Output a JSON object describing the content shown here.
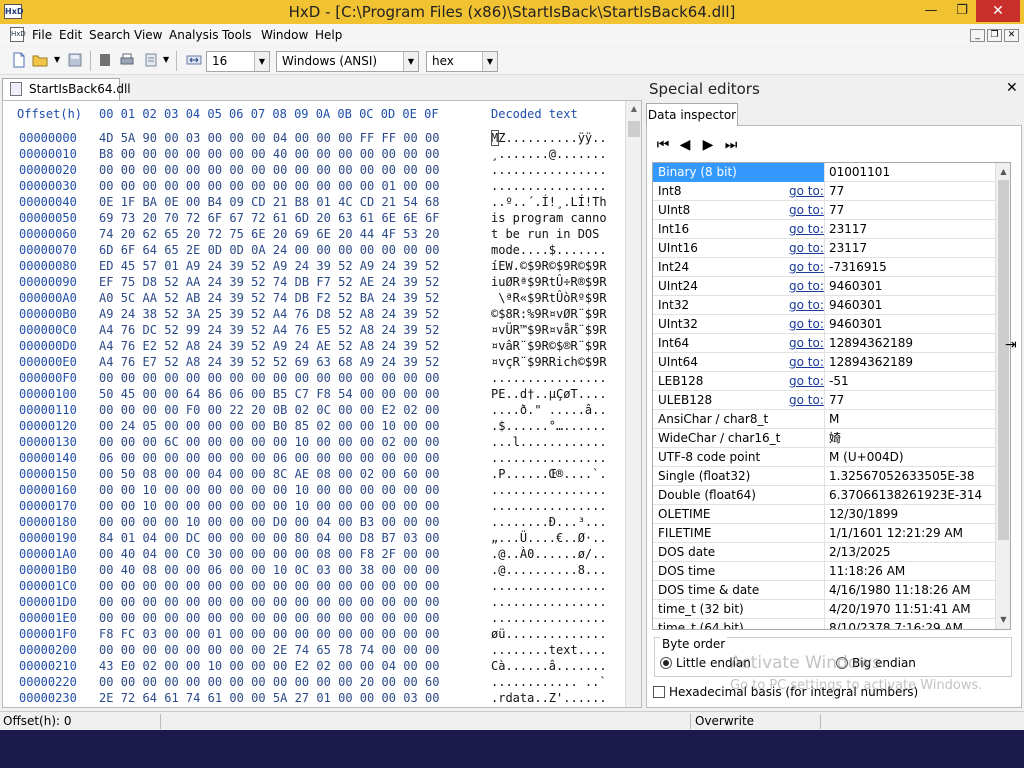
{
  "window": {
    "title": "HxD - [C:\\Program Files (x86)\\StartIsBack\\StartIsBack64.dll]",
    "app_icon": "HxD"
  },
  "menu": [
    "File",
    "Edit",
    "Search",
    "View",
    "Analysis",
    "Tools",
    "Window",
    "Help"
  ],
  "toolbar": {
    "bytes_per_row": "16",
    "charset": "Windows (ANSI)",
    "offset_base": "hex"
  },
  "document_tab": "StartIsBack64.dll",
  "hex": {
    "header_offset": "Offset(h)",
    "header_columns": [
      "00",
      "01",
      "02",
      "03",
      "04",
      "05",
      "06",
      "07",
      "08",
      "09",
      "0A",
      "0B",
      "0C",
      "0D",
      "0E",
      "0F"
    ],
    "header_text": "Decoded text",
    "rows": [
      {
        "o": "00000000",
        "h": "4D 5A 90 00 03 00 00 00 04 00 00 00 FF FF 00 00",
        "t": "MZ..........ÿÿ.."
      },
      {
        "o": "00000010",
        "h": "B8 00 00 00 00 00 00 00 40 00 00 00 00 00 00 00",
        "t": "¸.......@......."
      },
      {
        "o": "00000020",
        "h": "00 00 00 00 00 00 00 00 00 00 00 00 00 00 00 00",
        "t": "................"
      },
      {
        "o": "00000030",
        "h": "00 00 00 00 00 00 00 00 00 00 00 00 00 01 00 00",
        "t": "................"
      },
      {
        "o": "00000040",
        "h": "0E 1F BA 0E 00 B4 09 CD 21 B8 01 4C CD 21 54 68",
        "t": "..º..´.Í!¸.LÍ!Th"
      },
      {
        "o": "00000050",
        "h": "69 73 20 70 72 6F 67 72 61 6D 20 63 61 6E 6E 6F",
        "t": "is program canno"
      },
      {
        "o": "00000060",
        "h": "74 20 62 65 20 72 75 6E 20 69 6E 20 44 4F 53 20",
        "t": "t be run in DOS "
      },
      {
        "o": "00000070",
        "h": "6D 6F 64 65 2E 0D 0D 0A 24 00 00 00 00 00 00 00",
        "t": "mode....$......."
      },
      {
        "o": "00000080",
        "h": "ED 45 57 01 A9 24 39 52 A9 24 39 52 A9 24 39 52",
        "t": "íEW.©$9R©$9R©$9R"
      },
      {
        "o": "00000090",
        "h": "EF 75 D8 52 AA 24 39 52 74 DB F7 52 AE 24 39 52",
        "t": "iuØRª$9RtÛ÷R®$9R"
      },
      {
        "o": "000000A0",
        "h": "A0 5C AA 52 AB 24 39 52 74 DB F2 52 BA 24 39 52",
        "t": " \\ªR«$9RtÛòRº$9R"
      },
      {
        "o": "000000B0",
        "h": "A9 24 38 52 3A 25 39 52 A4 76 D8 52 A8 24 39 52",
        "t": "©$8R:%9R¤vØR¨$9R"
      },
      {
        "o": "000000C0",
        "h": "A4 76 DC 52 99 24 39 52 A4 76 E5 52 A8 24 39 52",
        "t": "¤vÜR™$9R¤våR¨$9R"
      },
      {
        "o": "000000D0",
        "h": "A4 76 E2 52 A8 24 39 52 A9 24 AE 52 A8 24 39 52",
        "t": "¤vâR¨$9R©$®R¨$9R"
      },
      {
        "o": "000000E0",
        "h": "A4 76 E7 52 A8 24 39 52 52 69 63 68 A9 24 39 52",
        "t": "¤vçR¨$9RRich©$9R"
      },
      {
        "o": "000000F0",
        "h": "00 00 00 00 00 00 00 00 00 00 00 00 00 00 00 00",
        "t": "................"
      },
      {
        "o": "00000100",
        "h": "50 45 00 00 64 86 06 00 B5 C7 F8 54 00 00 00 00",
        "t": "PE..d†..µÇøT...."
      },
      {
        "o": "00000110",
        "h": "00 00 00 00 F0 00 22 20 0B 02 0C 00 00 E2 02 00",
        "t": "....ð.\" .....â.."
      },
      {
        "o": "00000120",
        "h": "00 24 05 00 00 00 00 00 B0 85 02 00 00 10 00 00",
        "t": ".$......°…......"
      },
      {
        "o": "00000130",
        "h": "00 00 00 6C 00 00 00 00 00 10 00 00 00 02 00 00",
        "t": "...l............"
      },
      {
        "o": "00000140",
        "h": "06 00 00 00 00 00 00 00 06 00 00 00 00 00 00 00",
        "t": "................"
      },
      {
        "o": "00000150",
        "h": "00 50 08 00 00 04 00 00 8C AE 08 00 02 00 60 00",
        "t": ".P......Œ®....`."
      },
      {
        "o": "00000160",
        "h": "00 00 10 00 00 00 00 00 00 10 00 00 00 00 00 00",
        "t": "................"
      },
      {
        "o": "00000170",
        "h": "00 00 10 00 00 00 00 00 00 10 00 00 00 00 00 00",
        "t": "................"
      },
      {
        "o": "00000180",
        "h": "00 00 00 00 10 00 00 00 D0 00 04 00 B3 00 00 00",
        "t": "........Ð...³..."
      },
      {
        "o": "00000190",
        "h": "84 01 04 00 DC 00 00 00 00 80 04 00 D8 B7 03 00",
        "t": "„...Ü....€..Ø·.."
      },
      {
        "o": "000001A0",
        "h": "00 40 04 00 C0 30 00 00 00 00 08 00 F8 2F 00 00",
        "t": ".@..À0......ø/.."
      },
      {
        "o": "000001B0",
        "h": "00 40 08 00 00 06 00 00 10 0C 03 00 38 00 00 00",
        "t": ".@..........8..."
      },
      {
        "o": "000001C0",
        "h": "00 00 00 00 00 00 00 00 00 00 00 00 00 00 00 00",
        "t": "................"
      },
      {
        "o": "000001D0",
        "h": "00 00 00 00 00 00 00 00 00 00 00 00 00 00 00 00",
        "t": "................"
      },
      {
        "o": "000001E0",
        "h": "00 00 00 00 00 00 00 00 00 00 00 00 00 00 00 00",
        "t": "................"
      },
      {
        "o": "000001F0",
        "h": "F8 FC 03 00 00 01 00 00 00 00 00 00 00 00 00 00",
        "t": "øü.............."
      },
      {
        "o": "00000200",
        "h": "00 00 00 00 00 00 00 00 2E 74 65 78 74 00 00 00",
        "t": "........text...."
      },
      {
        "o": "00000210",
        "h": "43 E0 02 00 00 10 00 00 00 E2 02 00 00 04 00 00",
        "t": "Cà......â......."
      },
      {
        "o": "00000220",
        "h": "00 00 00 00 00 00 00 00 00 00 00 00 20 00 00 60",
        "t": "............ ..`"
      },
      {
        "o": "00000230",
        "h": "2E 72 64 61 74 61 00 00 5A 27 01 00 00 00 03 00",
        "t": ".rdata..Z'......"
      }
    ]
  },
  "special_editors": {
    "title": "Special editors",
    "tab": "Data inspector",
    "goto_label": "go to:",
    "rows": [
      {
        "label": "Binary (8 bit)",
        "goto": false,
        "value": "01001101"
      },
      {
        "label": "Int8",
        "goto": true,
        "value": "77"
      },
      {
        "label": "UInt8",
        "goto": true,
        "value": "77"
      },
      {
        "label": "Int16",
        "goto": true,
        "value": "23117"
      },
      {
        "label": "UInt16",
        "goto": true,
        "value": "23117"
      },
      {
        "label": "Int24",
        "goto": true,
        "value": "-7316915"
      },
      {
        "label": "UInt24",
        "goto": true,
        "value": "9460301"
      },
      {
        "label": "Int32",
        "goto": true,
        "value": "9460301"
      },
      {
        "label": "UInt32",
        "goto": true,
        "value": "9460301"
      },
      {
        "label": "Int64",
        "goto": true,
        "value": "12894362189"
      },
      {
        "label": "UInt64",
        "goto": true,
        "value": "12894362189"
      },
      {
        "label": "LEB128",
        "goto": true,
        "value": "-51"
      },
      {
        "label": "ULEB128",
        "goto": true,
        "value": "77"
      },
      {
        "label": "AnsiChar / char8_t",
        "goto": false,
        "value": "M"
      },
      {
        "label": "WideChar / char16_t",
        "goto": false,
        "value": "婍"
      },
      {
        "label": "UTF-8 code point",
        "goto": false,
        "value": "M (U+004D)"
      },
      {
        "label": "Single (float32)",
        "goto": false,
        "value": "1.32567052633505E-38"
      },
      {
        "label": "Double (float64)",
        "goto": false,
        "value": "6.37066138261923E-314"
      },
      {
        "label": "OLETIME",
        "goto": false,
        "value": "12/30/1899"
      },
      {
        "label": "FILETIME",
        "goto": false,
        "value": "1/1/1601 12:21:29 AM"
      },
      {
        "label": "DOS date",
        "goto": false,
        "value": "2/13/2025"
      },
      {
        "label": "DOS time",
        "goto": false,
        "value": "11:18:26 AM"
      },
      {
        "label": "DOS time & date",
        "goto": false,
        "value": "4/16/1980 11:18:26 AM"
      },
      {
        "label": "time_t (32 bit)",
        "goto": false,
        "value": "4/20/1970 11:51:41 AM"
      },
      {
        "label": "time_t (64 bit)",
        "goto": false,
        "value": "8/10/2378 7:16:29 AM"
      }
    ],
    "byte_order_title": "Byte order",
    "little_endian": "Little endian",
    "big_endian": "Big endian",
    "hex_basis": "Hexadecimal basis (for integral numbers)"
  },
  "watermark": {
    "line1": "Activate Windows",
    "line2": "Go to PC settings to activate Windows."
  },
  "status": {
    "offset": "Offset(h): 0",
    "mode": "Overwrite"
  }
}
